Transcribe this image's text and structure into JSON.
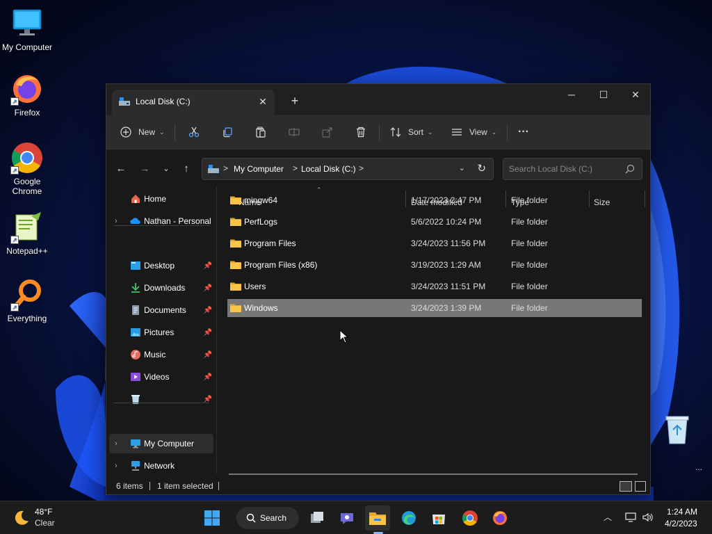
{
  "desktop": {
    "icons": [
      {
        "label": "My Computer",
        "icon": "monitor-icon"
      },
      {
        "label": "Firefox",
        "icon": "firefox-icon"
      },
      {
        "label": "Google Chrome",
        "icon": "chrome-icon"
      },
      {
        "label": "Notepad++",
        "icon": "notepadpp-icon"
      },
      {
        "label": "Everything",
        "icon": "everything-search-icon"
      }
    ],
    "recycle_bin_icon": "recycle-bin-icon",
    "overflow": "..."
  },
  "window": {
    "tab_title": "Local Disk (C:)",
    "tab_close": "✕",
    "new_tab": "+",
    "controls": {
      "minimize": "─",
      "maximize": "☐",
      "close": "✕"
    },
    "toolbar": {
      "new_label": "New",
      "sort_label": "Sort",
      "view_label": "View",
      "more_label": "···",
      "icons": [
        "plus-circle-icon",
        "cut-icon",
        "copy-icon",
        "paste-icon",
        "rename-icon",
        "share-icon",
        "delete-icon",
        "sort-icon",
        "view-icon",
        "more-icon"
      ]
    },
    "address": {
      "crumbs": [
        "My Computer",
        "Local Disk (C:)"
      ],
      "separator": ">"
    },
    "search": {
      "placeholder": "Search Local Disk (C:)"
    },
    "sidebar": {
      "home": "Home",
      "onedrive": "Nathan - Personal",
      "quick_access": [
        {
          "label": "Desktop",
          "icon": "desktop-folder-icon"
        },
        {
          "label": "Downloads",
          "icon": "downloads-icon"
        },
        {
          "label": "Documents",
          "icon": "documents-icon"
        },
        {
          "label": "Pictures",
          "icon": "pictures-icon"
        },
        {
          "label": "Music",
          "icon": "music-icon"
        },
        {
          "label": "Videos",
          "icon": "videos-icon"
        },
        {
          "label": "",
          "icon": "recycle-bin-icon"
        }
      ],
      "my_computer": "My Computer",
      "network": "Network"
    },
    "columns": {
      "name": "Name",
      "date": "Date modified",
      "type": "Type",
      "size": "Size"
    },
    "rows": [
      {
        "name": "mingw64",
        "date": "1/17/2023 2:47 PM",
        "type": "File folder"
      },
      {
        "name": "PerfLogs",
        "date": "5/6/2022 10:24 PM",
        "type": "File folder"
      },
      {
        "name": "Program Files",
        "date": "3/24/2023 11:56 PM",
        "type": "File folder"
      },
      {
        "name": "Program Files (x86)",
        "date": "3/19/2023 1:29 AM",
        "type": "File folder"
      },
      {
        "name": "Users",
        "date": "3/24/2023 11:51 PM",
        "type": "File folder"
      },
      {
        "name": "Windows",
        "date": "3/24/2023 1:39 PM",
        "type": "File folder",
        "selected": true
      }
    ],
    "status": {
      "count": "6 items",
      "selected": "1 item selected"
    }
  },
  "taskbar": {
    "weather_temp": "48°F",
    "weather_cond": "Clear",
    "search_label": "Search",
    "apps": [
      "windows-start-icon",
      "task-view-icon",
      "teams-chat-icon",
      "file-explorer-icon",
      "edge-icon",
      "store-icon",
      "chrome-icon",
      "firefox-icon"
    ],
    "time": "1:24 AM",
    "date": "4/2/2023"
  },
  "colors": {
    "accent": "#0078d4",
    "selected_row": "#777777",
    "folder": "#f8c54a"
  }
}
